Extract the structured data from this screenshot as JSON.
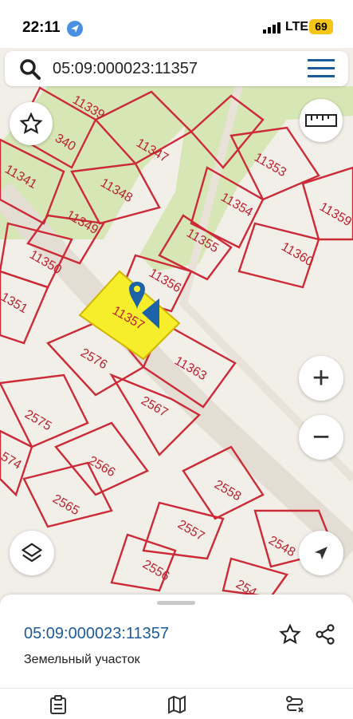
{
  "status_bar": {
    "time": "22:11",
    "network": "LTE",
    "battery": "69"
  },
  "search": {
    "query": "05:09:000023:11357"
  },
  "map": {
    "parcel_labels": [
      "11339",
      "340",
      "11347",
      "11341",
      "11348",
      "11353",
      "11349",
      "11354",
      "11359",
      "11355",
      "11350",
      "11360",
      "11356",
      "1351",
      "11357",
      "2576",
      "11363",
      "2567",
      "2575",
      "574",
      "2566",
      "2565",
      "2558",
      "2557",
      "2548",
      "2556",
      "254"
    ],
    "selected_parcel": "11357",
    "colors": {
      "parcel_border": "#cc2a36",
      "label": "#b8232f",
      "green_area": "#d6e6b5",
      "selected_fill": "#f7ee2b",
      "marker": "#1e63a8"
    },
    "controls": {
      "favorite": "star-icon",
      "ruler": "ruler-icon",
      "zoom_in": "+",
      "zoom_out": "−",
      "layers": "layers-icon",
      "locate": "navigation-arrow-icon"
    }
  },
  "sheet": {
    "parcel_code": "05:09:000023:11357",
    "parcel_type": "Земельный участок"
  },
  "tabbar": {
    "tabs": [
      "clipboard-icon",
      "map-icon",
      "route-icon"
    ]
  }
}
